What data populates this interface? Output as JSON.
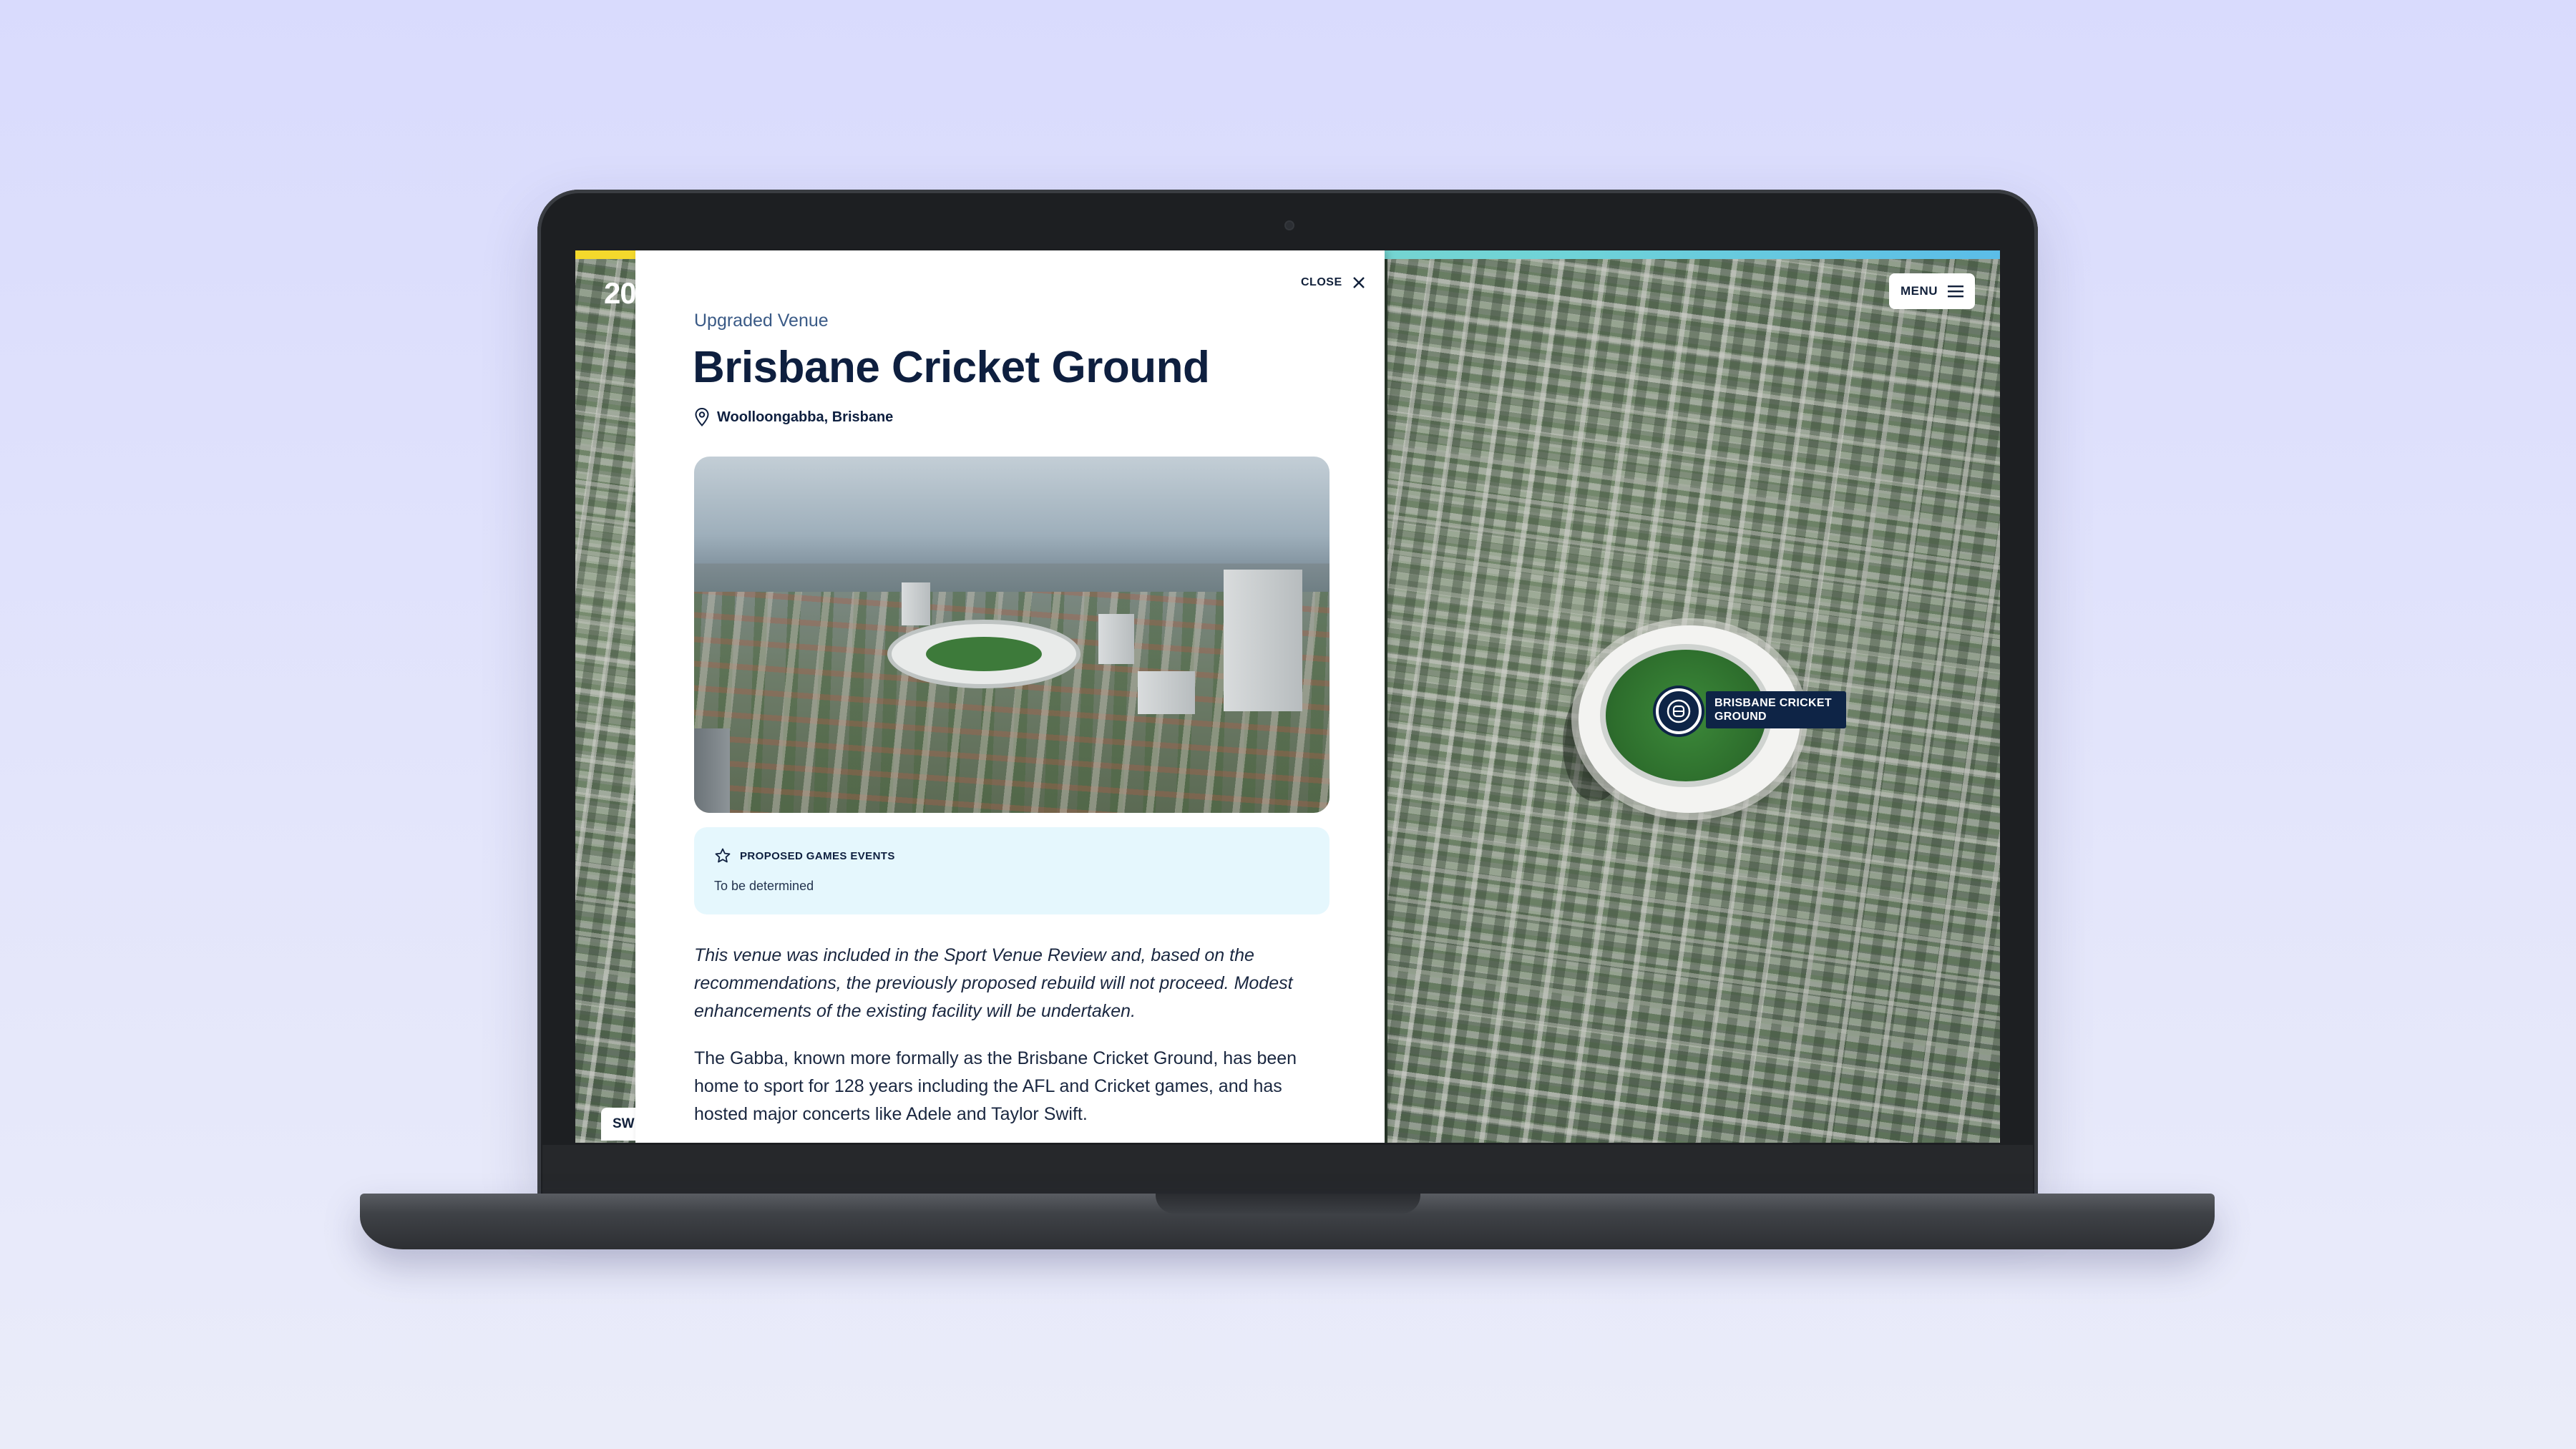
{
  "map": {
    "left_strip_logo": "20",
    "left_strip_logo_accent": "",
    "left_strip_tab": "SW",
    "menu_label": "MENU",
    "pin_label": "BRISBANE CRICKET GROUND"
  },
  "panel": {
    "close_label": "CLOSE",
    "eyebrow": "Upgraded Venue",
    "title": "Brisbane Cricket Ground",
    "location": "Woolloongabba, Brisbane",
    "events": {
      "heading": "PROPOSED GAMES EVENTS",
      "value": "To be determined"
    },
    "note": "This venue was included in the Sport Venue Review and, based on the recommendations, the previously proposed rebuild will not proceed. Modest enhancements of the existing facility will be undertaken.",
    "body": "The Gabba, known more formally as the Brisbane Cricket Ground, has been home to sport for 128 years including the AFL and Cricket games, and has hosted major concerts like Adele and Taylor Swift."
  },
  "colors": {
    "navy": "#0e1f3f",
    "pin": "#0e2446",
    "events_bg": "#e5f7fd",
    "eyebrow": "#3a5a86",
    "bar_yellow": "#f4d92c",
    "bar_teal": "#6fd3d8",
    "bar_blue": "#5bbde8"
  },
  "icons": {
    "close": "close-icon",
    "location": "map-pin-icon",
    "events": "star-icon",
    "menu": "hamburger-icon",
    "venue": "stadium-icon"
  }
}
